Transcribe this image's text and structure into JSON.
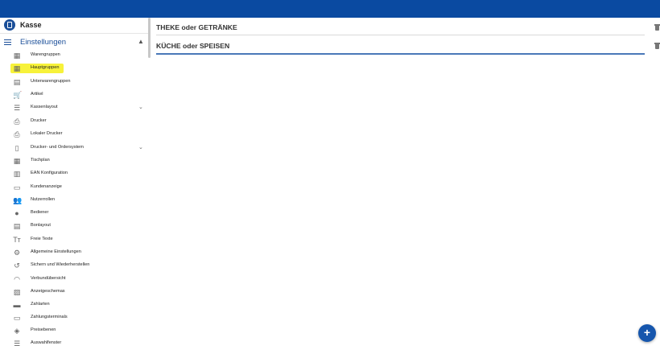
{
  "app": {
    "title": "Kasse"
  },
  "sidebar": {
    "section_title": "Einstellungen",
    "items": [
      {
        "label": "Warengruppen",
        "icon": "grid-icon"
      },
      {
        "label": "Hauptgruppen",
        "icon": "grid-icon",
        "active": true
      },
      {
        "label": "Unterwarengruppen",
        "icon": "grid-light-icon"
      },
      {
        "label": "Artikel",
        "icon": "cart-icon"
      },
      {
        "label": "Kassenlayout",
        "icon": "lines-icon",
        "expandable": true
      },
      {
        "label": "Drucker",
        "icon": "printer-icon"
      },
      {
        "label": "Lokaler Drucker",
        "icon": "printer-icon"
      },
      {
        "label": "Drucker- und Ordersystem",
        "icon": "device-icon",
        "expandable": true
      },
      {
        "label": "Tischplan",
        "icon": "table-grid-icon"
      },
      {
        "label": "EAN Konfiguration",
        "icon": "barcode-icon"
      },
      {
        "label": "Kundenanzeige",
        "icon": "monitor-icon"
      },
      {
        "label": "Nutzerrollen",
        "icon": "people-icon"
      },
      {
        "label": "Bediener",
        "icon": "person-icon"
      },
      {
        "label": "Bonlayout",
        "icon": "receipt-icon"
      },
      {
        "label": "Freie Texte",
        "icon": "text-icon"
      },
      {
        "label": "Allgemeine Einstellungen",
        "icon": "gear-icon"
      },
      {
        "label": "Sichern und Wiederherstellen",
        "icon": "history-icon"
      },
      {
        "label": "Verbundübersicht",
        "icon": "wifi-icon"
      },
      {
        "label": "Anzeigeschemas",
        "icon": "image-icon"
      },
      {
        "label": "Zahlarten",
        "icon": "cash-icon"
      },
      {
        "label": "Zahlungsterminals",
        "icon": "card-icon"
      },
      {
        "label": "Preisebenen",
        "icon": "layers-icon"
      },
      {
        "label": "Auswahlfenster",
        "icon": "lines-icon"
      }
    ]
  },
  "main": {
    "groups": [
      {
        "label": "THEKE oder GETRÄNKE"
      },
      {
        "label": "KÜCHE oder SPEISEN"
      }
    ]
  },
  "colors": {
    "topbar": "#0a4aa1",
    "accent": "#1b4f99",
    "highlight": "#f7f23a"
  }
}
